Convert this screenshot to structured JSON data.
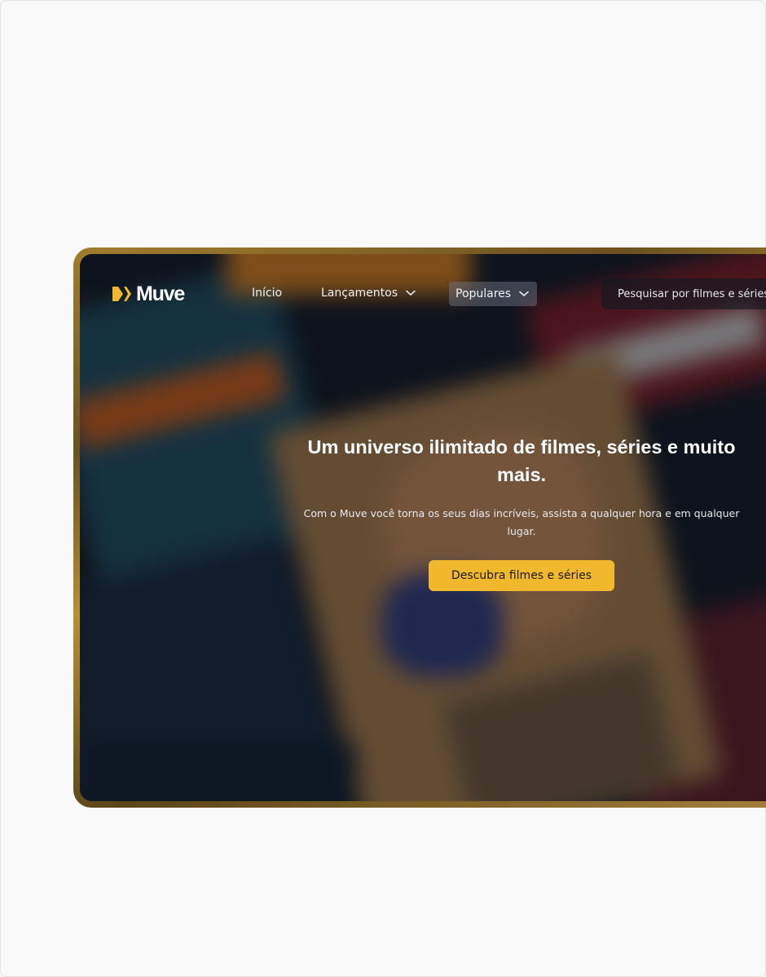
{
  "brand": {
    "name": "Muve",
    "accent_color": "#f2b82d"
  },
  "nav": {
    "home_label": "Início",
    "launches_label": "Lançamentos",
    "popular_label": "Populares",
    "search_placeholder": "Pesquisar por filmes e séries"
  },
  "hero": {
    "headline": "Um universo ilimitado de filmes, séries e muito mais.",
    "subtitle": "Com o Muve você torna os seus dias incríveis, assista a qualquer hora e em qualquer lugar.",
    "cta_label": "Descubra filmes e séries"
  },
  "icons": {
    "logo_mark": "double-chevron-play-icon",
    "dropdown": "chevron-down-icon"
  }
}
